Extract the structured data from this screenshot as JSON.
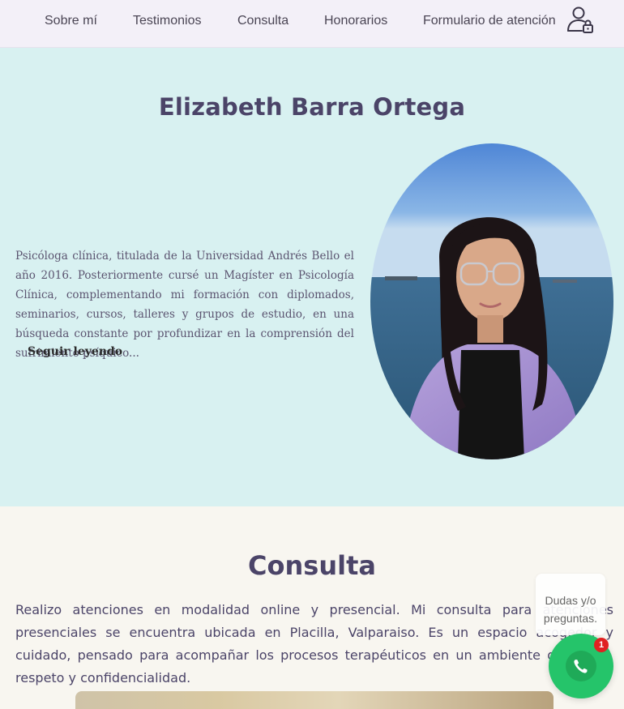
{
  "nav": {
    "items": [
      {
        "label": "Sobre mí"
      },
      {
        "label": "Testimonios"
      },
      {
        "label": "Consulta"
      },
      {
        "label": "Honorarios"
      },
      {
        "label": "Formulario de atención"
      }
    ],
    "user_icon": "user-lock-icon"
  },
  "hero": {
    "title": "Elizabeth Barra Ortega",
    "bio": "Psicóloga clínica, titulada de la Universidad Andrés Bello el año 2016. Posteriormente cursé un Magíster en Psicología Clínica, complementando mi formación con diplomados, seminarios, cursos, talleres y grupos de estudio, en una búsqueda constante por profundizar en la comprensión del sufrimiento psíquico...",
    "read_more": "Seguir leyendo"
  },
  "consulta": {
    "title": "Consulta",
    "text": "Realizo atenciones en modalidad online y presencial. Mi consulta para atenciones presenciales se encuentra ubicada en Placilla, Valparaiso. Es un espacio acogedor y cuidado, pensado para acompañar los procesos terapéuticos en un ambiente de calma, respeto y confidencialidad."
  },
  "chat": {
    "bubble_text": "Dudas y/o preguntas.",
    "badge_count": "1",
    "icon": "phone-icon"
  },
  "colors": {
    "nav_bg": "#f3f0f8",
    "hero_bg": "#d8f1f1",
    "title": "#4b4468",
    "whatsapp": "#25c46a",
    "badge": "#e02121"
  }
}
